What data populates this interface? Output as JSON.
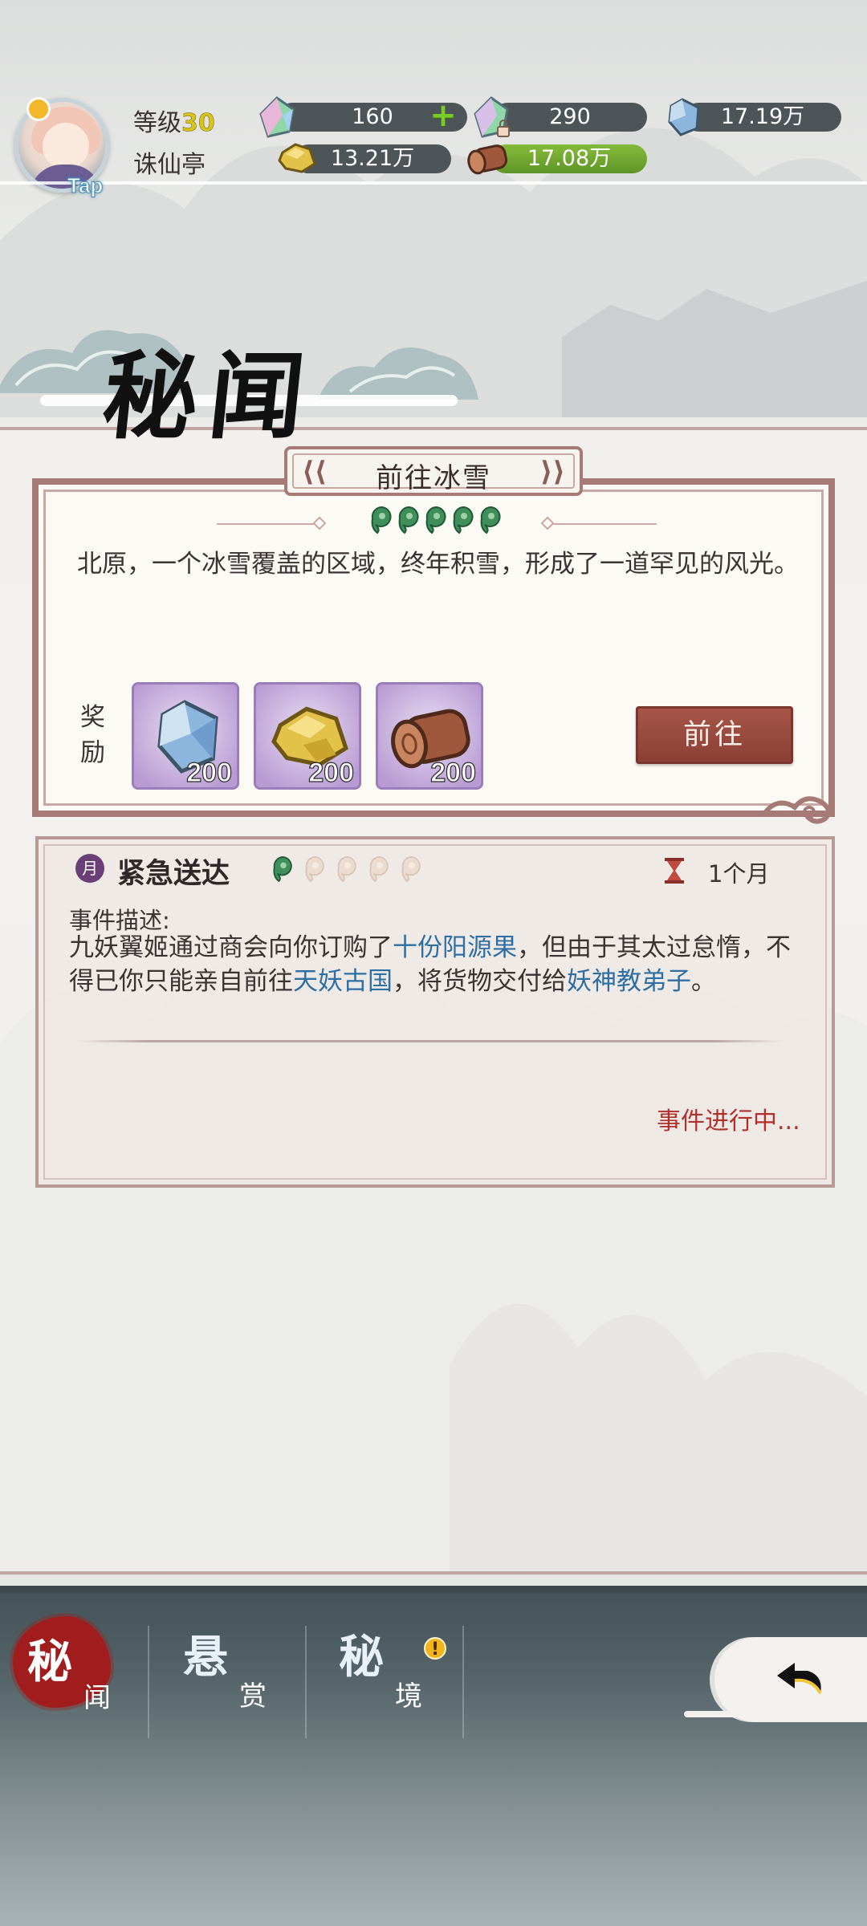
{
  "player": {
    "level_label": "等级",
    "level": "30",
    "location": "诛仙亭",
    "tap_label": "Tap"
  },
  "resources": {
    "jade_rainbow": {
      "icon": "rainbow-crystal-icon",
      "value": "160"
    },
    "jade_locked": {
      "icon": "locked-crystal-icon",
      "value": "290"
    },
    "ice_crystal": {
      "icon": "ice-crystal-icon",
      "value": "17.19万"
    },
    "gold_ore": {
      "icon": "gold-ore-icon",
      "value": "13.21万"
    },
    "wood": {
      "icon": "wood-log-icon",
      "value": "17.08万"
    },
    "plus_symbol": "+"
  },
  "page": {
    "title": "秘闻"
  },
  "featured_event": {
    "title": "前往冰雪",
    "difficulty_stars": 5,
    "description": "北原，一个冰雪覆盖的区域，终年积雪，形成了一道罕见的风光。",
    "reward_label": "奖励",
    "rewards": [
      {
        "icon": "ice-crystal-icon",
        "count": "200"
      },
      {
        "icon": "gold-ore-icon",
        "count": "200"
      },
      {
        "icon": "wood-log-icon",
        "count": "200"
      }
    ],
    "go_button": "前往"
  },
  "urgent_event": {
    "badge": "月",
    "title": "紧急送达",
    "difficulty_stars_filled": 1,
    "difficulty_stars_total": 5,
    "duration": "1个月",
    "desc_label": "事件描述:",
    "desc_parts": {
      "p1": "九妖翼姬通过商会向你订购了",
      "h1": "十份阳源果",
      "p2": "，但由于其太过怠惰，不得已你只能亲自前往",
      "h2": "天妖古国",
      "p3": "，将货物交付给",
      "h3": "妖神教弟子",
      "p4": "。"
    },
    "status": "事件进行中..."
  },
  "bottom_nav": {
    "tabs": [
      {
        "main": "秘",
        "sub": "闻",
        "active": true
      },
      {
        "main": "悬",
        "sub": "赏",
        "active": false
      },
      {
        "main": "秘",
        "sub": "境",
        "active": false,
        "alert": "!"
      }
    ],
    "back_icon": "back-arrow-icon"
  },
  "colors": {
    "accent_red": "#8a3f34",
    "frame_brown": "#a67a76",
    "highlight_blue": "#2d6fa5",
    "status_red": "#b0302b",
    "reward_purple": "#b99bd3"
  }
}
